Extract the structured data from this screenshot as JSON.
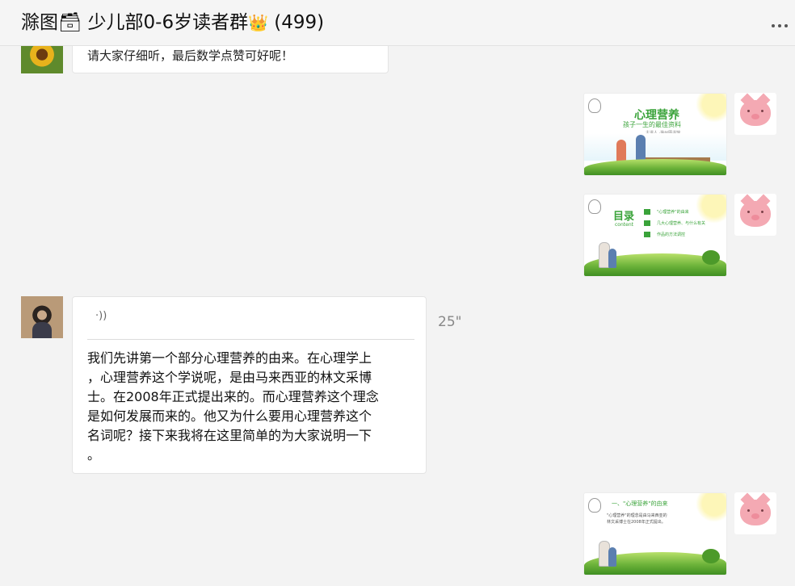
{
  "header": {
    "title": "滁图🗃 少儿部0-6岁读者群",
    "crown_emoji": "👑",
    "member_count": "(499)"
  },
  "messages": [
    {
      "id": "msg-prev",
      "sender": "other",
      "avatar_icon": "sunflower-avatar",
      "text": "请大家仔细听，最后数学点赞可好呢！"
    },
    {
      "id": "msg-slide-1",
      "sender": "self",
      "avatar_icon": "pig-avatar",
      "slide_title": "心理营养",
      "slide_subtitle": "孩子一生的最佳资料",
      "slide_caption": "主讲人 ·滁州图书馆"
    },
    {
      "id": "msg-slide-2",
      "sender": "self",
      "avatar_icon": "pig-avatar",
      "slide_title": "目录",
      "slide_en": "content",
      "items": [
        "\"心理营养\"的由来",
        "几大心理营养、与什么有关",
        "作品的方法调控"
      ]
    },
    {
      "id": "msg-voice",
      "sender": "other",
      "avatar_icon": "woman-avatar",
      "voice_icon": "voice-wave-icon",
      "voice_glyph": "·))",
      "duration": "25\"",
      "transcript_lines": [
        "我们先讲第一个部分心理营养的由来。在心理学上",
        "，心理营养这个学说呢，是由马来西亚的林文采博",
        "士。在2008年正式提出来的。而心理营养这个理念",
        "是如何发展而来的。他又为什么要用心理营养这个",
        "名词呢？接下来我将在这里简单的为大家说明一下",
        "。"
      ]
    },
    {
      "id": "msg-slide-3",
      "sender": "self",
      "avatar_icon": "pig-avatar",
      "slide_title": "一、\"心理营养\"的由来",
      "lines": [
        "\"心理营养\"的理念是由马来西亚的",
        "林文采博士在2008年正式提出。"
      ]
    }
  ],
  "colors": {
    "background": "#f3f3f3",
    "bubble": "#ffffff",
    "slide_green": "#3aa33a"
  }
}
